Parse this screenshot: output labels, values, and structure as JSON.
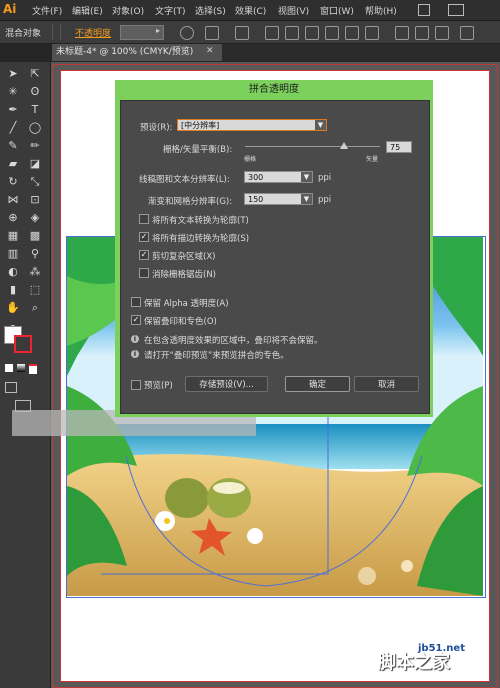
{
  "app": {
    "logo": "Ai"
  },
  "menus": [
    "文件(F)",
    "编辑(E)",
    "对象(O)",
    "文字(T)",
    "选择(S)",
    "效果(C)",
    "视图(V)",
    "窗口(W)",
    "帮助(H)"
  ],
  "control_bar": {
    "blend_label": "混合对象",
    "opacity_label": "不透明度"
  },
  "tab": {
    "title": "未标题-4* @ 100% (CMYK/预览)",
    "close": "✕"
  },
  "dialog": {
    "title": "拼合透明度",
    "preset_label": "预设(R):",
    "preset_value": "[中分辨率]",
    "balance_label": "栅格/矢量平衡(B):",
    "balance_value": "75",
    "balance_min": "栅格",
    "balance_max": "矢量",
    "line_art_label": "线稿图和文本分辨率(L):",
    "line_art_value": "300",
    "gradient_label": "渐变和网格分辨率(G):",
    "gradient_value": "150",
    "ppi": "ppi",
    "options": [
      {
        "label": "将所有文本转换为轮廓(T)",
        "checked": false
      },
      {
        "label": "将所有描边转换为轮廓(S)",
        "checked": true
      },
      {
        "label": "剪切复杂区域(X)",
        "checked": true
      },
      {
        "label": "消除栅格锯齿(N)",
        "checked": false
      }
    ],
    "preserve_alpha": {
      "label": "保留 Alpha 透明度(A)",
      "checked": false
    },
    "preserve_overprint": {
      "label": "保留叠印和专色(O)",
      "checked": true
    },
    "info1": "在包含透明度效果的区域中，叠印将不会保留。",
    "info2": "请打开“叠印预览”来预览拼合的专色。",
    "preview_label": "预览(P)",
    "save_preset_label": "存储预设(V)...",
    "ok_label": "确定",
    "cancel_label": "取消"
  },
  "watermark": {
    "text": "脚本之家",
    "url": "jb51.net"
  },
  "colors": {
    "accent": "#7bd15c",
    "orange": "#f29b1e",
    "dialog_bg": "#4a4a4a"
  }
}
